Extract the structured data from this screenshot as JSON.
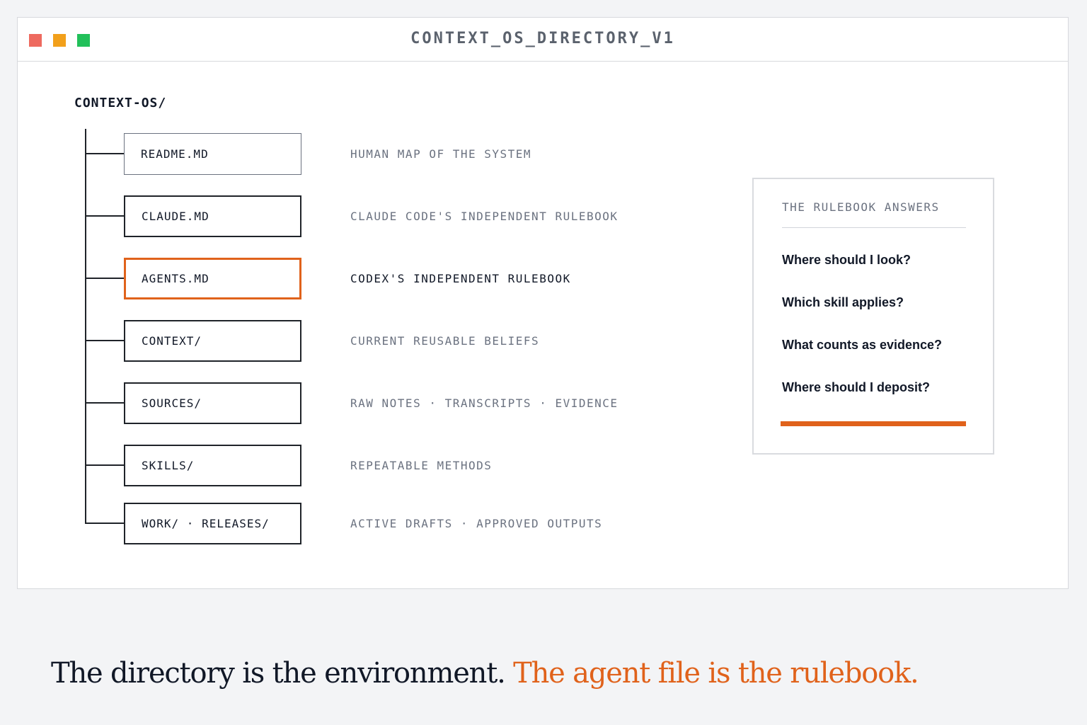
{
  "window": {
    "title": "CONTEXT_OS_DIRECTORY_V1",
    "controls": [
      {
        "name": "close",
        "color": "#ee6a5f"
      },
      {
        "name": "minimize",
        "color": "#f2a01b"
      },
      {
        "name": "maximize",
        "color": "#22c05a"
      }
    ]
  },
  "tree": {
    "root": "CONTEXT-OS/",
    "items": [
      {
        "label": "README.MD",
        "description": "HUMAN MAP OF THE SYSTEM"
      },
      {
        "label": "CLAUDE.MD",
        "description": "CLAUDE CODE'S INDEPENDENT RULEBOOK"
      },
      {
        "label": "AGENTS.MD",
        "description": "CODEX'S INDEPENDENT RULEBOOK",
        "highlighted": true
      },
      {
        "label": "CONTEXT/",
        "description": "CURRENT REUSABLE BELIEFS"
      },
      {
        "label": "SOURCES/",
        "description": "RAW NOTES · TRANSCRIPTS · EVIDENCE"
      },
      {
        "label": "SKILLS/",
        "description": "REPEATABLE METHODS"
      },
      {
        "label": "WORK/ · RELEASES/",
        "description": "ACTIVE DRAFTS · APPROVED OUTPUTS"
      }
    ]
  },
  "panel": {
    "title": "THE RULEBOOK ANSWERS",
    "questions": [
      "Where should I look?",
      "Which skill applies?",
      "What counts as evidence?",
      "Where should I deposit?"
    ],
    "accent_color": "#e0621b"
  },
  "caption": {
    "main": "The directory is the environment.",
    "accent": "The agent file is the rulebook."
  },
  "colors": {
    "accent": "#e0621b",
    "ink": "#111827",
    "muted": "#6b7280"
  }
}
